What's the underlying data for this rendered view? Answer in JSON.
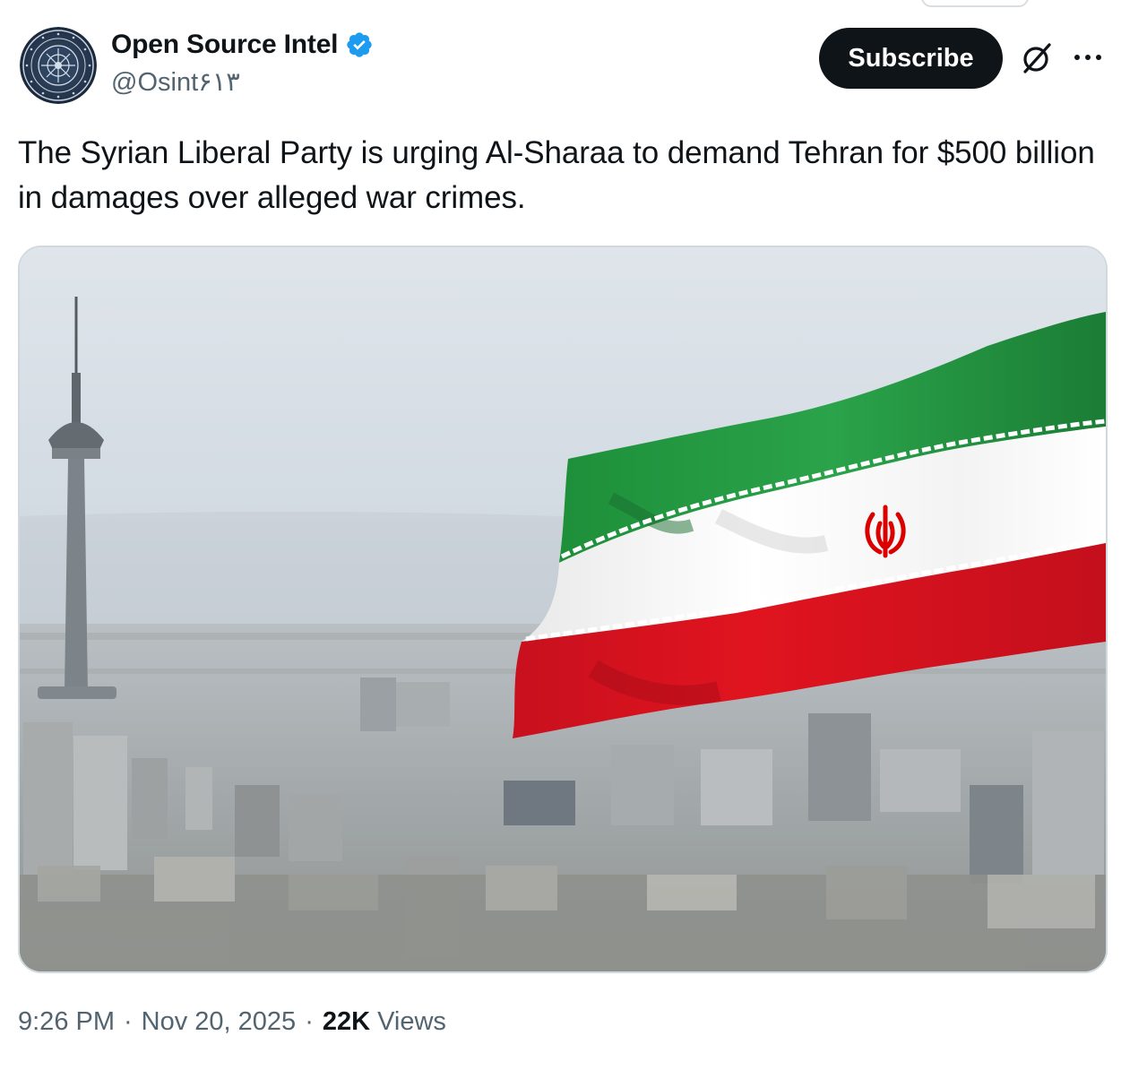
{
  "author": {
    "display_name": "Open Source Intel",
    "handle": "@Osint۶۱۳",
    "verified": true,
    "verified_color": "#1d9bf0",
    "avatar_icon": "osint-seal-logo"
  },
  "actions": {
    "subscribe_label": "Subscribe",
    "grok_icon": "grok-icon",
    "more_icon": "more-icon"
  },
  "tweet": {
    "text": "The Syrian Liberal Party is urging Al-Sharaa to demand Tehran for $500 billion in damages over alleged war crimes."
  },
  "media": {
    "type": "photo",
    "subject": "tehran-skyline-with-milad-tower-and-iranian-flag"
  },
  "meta": {
    "time": "9:26 PM",
    "separator": "·",
    "date": "Nov 20, 2025",
    "views_count": "22K",
    "views_label": "Views"
  },
  "colors": {
    "text_primary": "#0f1419",
    "text_secondary": "#536471",
    "button_bg": "#0f1419",
    "flag_green": "#239f40",
    "flag_white": "#ffffff",
    "flag_red": "#da0000"
  }
}
